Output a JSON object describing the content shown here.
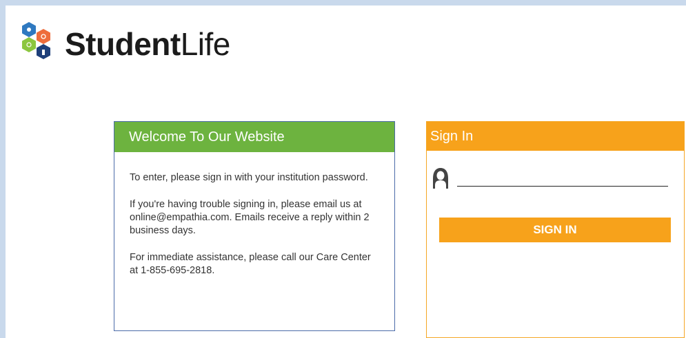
{
  "brand": {
    "bold": "Student",
    "light": "Life"
  },
  "welcome": {
    "title": "Welcome To Our Website",
    "paragraphs": [
      "To enter, please sign in with your institution password.",
      "If you're having trouble signing in, please email us at online@empathia.com. Emails receive a reply within 2 business days.",
      "For immediate assistance, please call our Care Center at 1-855-695-2818."
    ]
  },
  "signin": {
    "title": "Sign In",
    "password_value": "",
    "password_placeholder": "",
    "button_label": "SIGN IN"
  },
  "colors": {
    "green": "#6db33f",
    "orange": "#f7a21b",
    "hex_blue": "#2f79c0",
    "hex_orange": "#ee6d3c",
    "hex_lime": "#8cc63f",
    "hex_navy": "#1e3f7a"
  },
  "icons": {
    "logo": "hexagon-cluster-icon",
    "user": "user-icon"
  }
}
